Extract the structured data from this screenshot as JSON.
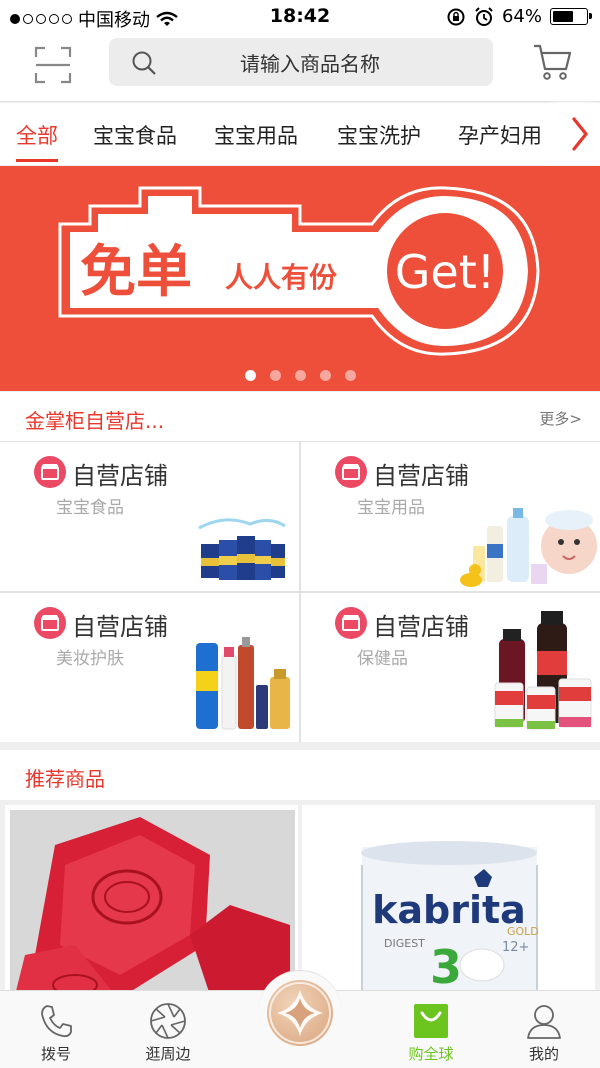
{
  "status_bar": {
    "carrier": "中国移动",
    "time": "18:42",
    "battery": "64%",
    "battery_level": 0.64
  },
  "header": {
    "search_placeholder": "请输入商品名称",
    "scan_icon": "scan-icon",
    "cart_icon": "cart-icon"
  },
  "tabs": {
    "items": [
      "全部",
      "宝宝食品",
      "宝宝用品",
      "宝宝洗护",
      "孕产妇用"
    ],
    "active_index": 0
  },
  "banner": {
    "title": "免单",
    "subtitle": "人人有份",
    "cta": "Get!",
    "slides": 5,
    "active_slide": 0
  },
  "stores": {
    "title": "金掌柜自营店...",
    "more": "更多>",
    "items": [
      {
        "title": "自营店铺",
        "subtitle": "宝宝食品"
      },
      {
        "title": "自营店铺",
        "subtitle": "宝宝用品"
      },
      {
        "title": "自营店铺",
        "subtitle": "美妆护肤"
      },
      {
        "title": "自营店铺",
        "subtitle": "保健品"
      }
    ]
  },
  "recommended": {
    "title": "推荐商品",
    "kabrita_brand": "kabrita",
    "kabrita_gold": "GOLD",
    "kabrita_digest": "DIGEST",
    "kabrita_stage": "3",
    "kabrita_age": "12+"
  },
  "bottom_nav": {
    "items": [
      {
        "label": "拨号",
        "icon": "phone-icon"
      },
      {
        "label": "逛周边",
        "icon": "aperture-icon"
      },
      {
        "label": "购全球",
        "icon": "shopping-bag-icon"
      },
      {
        "label": "我的",
        "icon": "user-icon"
      }
    ],
    "active_index": 2
  },
  "colors": {
    "accent": "#e8372c",
    "banner": "#ee4f3a",
    "store_badge": "#ec4965",
    "nav_active": "#6cc51f"
  }
}
